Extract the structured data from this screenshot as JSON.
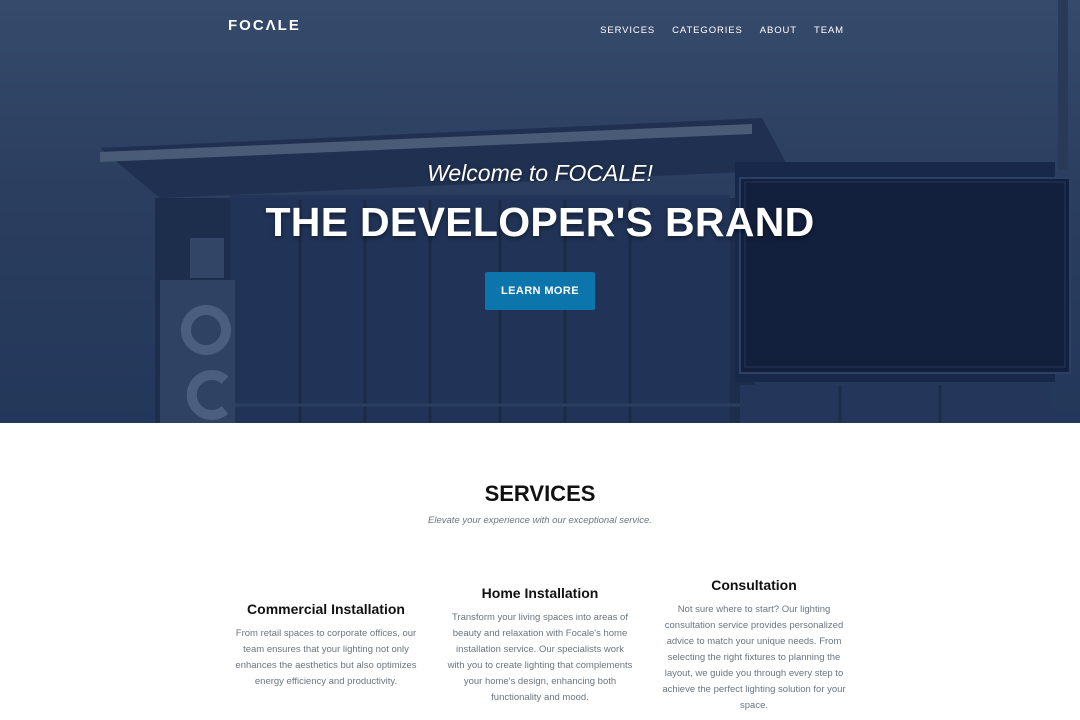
{
  "navbar": {
    "brand": "FOCΛLE",
    "links": [
      "SERVICES",
      "CATEGORIES",
      "ABOUT",
      "TEAM"
    ]
  },
  "hero": {
    "welcome": "Welcome to FOCALE!",
    "headline": "THE DEVELOPER'S BRAND",
    "cta_label": "LEARN MORE"
  },
  "services": {
    "title": "SERVICES",
    "subtitle": "Elevate your experience with our exceptional service.",
    "items": [
      {
        "title": "Commercial Installation",
        "text": "From retail spaces to corporate offices, our team ensures that your lighting not only enhances the aesthetics but also optimizes energy efficiency and productivity."
      },
      {
        "title": "Home Installation",
        "text": "Transform your living spaces into areas of beauty and relaxation with Focale's home installation service. Our specialists work with you to create lighting that complements your home's design, enhancing both functionality and mood."
      },
      {
        "title": "Consultation",
        "text": "Not sure where to start? Our lighting consultation service provides personalized advice to match your unique needs. From selecting the right fixtures to planning the layout, we guide you through every step to achieve the perfect lighting solution for your space."
      }
    ]
  },
  "colors": {
    "hero_overlay": "#2b3e5f",
    "cta": "#0c75ab",
    "heading": "#111111",
    "muted": "#6c757d"
  }
}
